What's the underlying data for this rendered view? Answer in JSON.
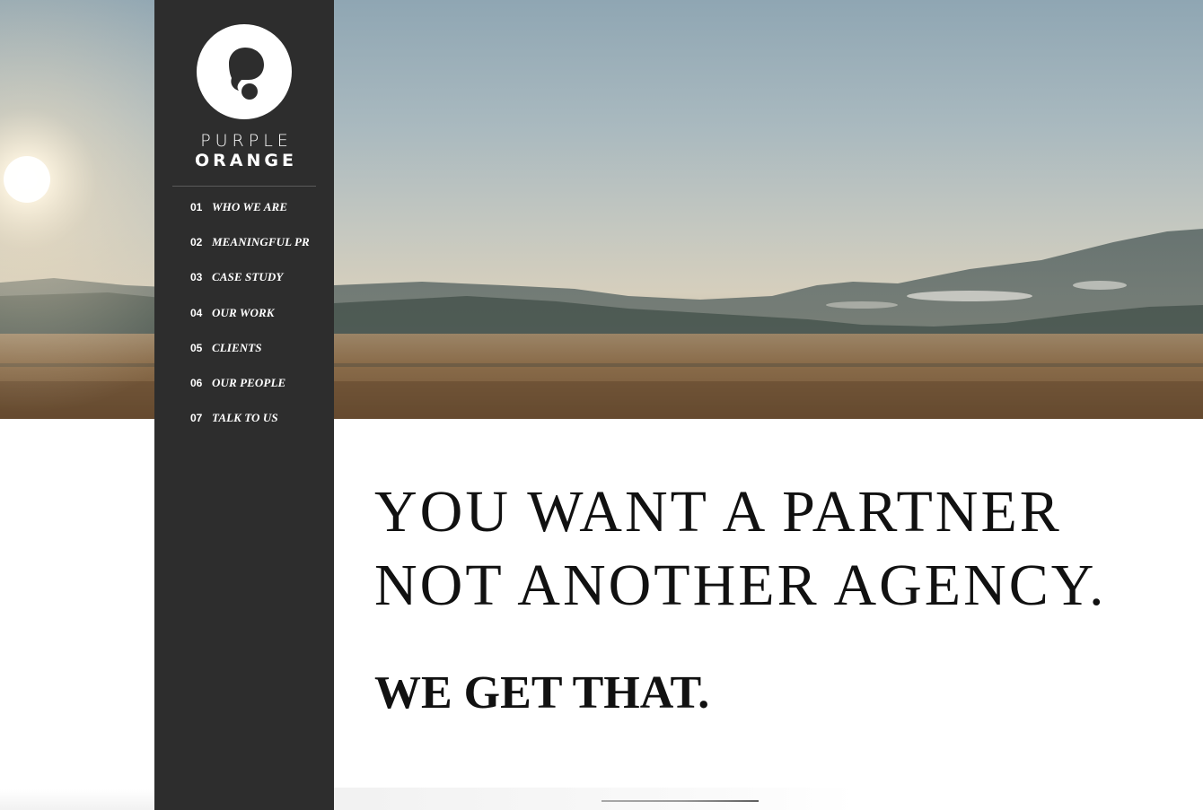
{
  "brand": {
    "line1": "PURPLE",
    "line2": "ORANGE",
    "logo_icon": "speech-bubble-logo-icon"
  },
  "nav": {
    "items": [
      {
        "num": "01",
        "label": "WHO WE ARE"
      },
      {
        "num": "02",
        "label": "MEANINGFUL PR"
      },
      {
        "num": "03",
        "label": "CASE STUDY"
      },
      {
        "num": "04",
        "label": "OUR WORK"
      },
      {
        "num": "05",
        "label": "CLIENTS"
      },
      {
        "num": "06",
        "label": "OUR PEOPLE"
      },
      {
        "num": "07",
        "label": "TALK TO US"
      }
    ]
  },
  "hero": {
    "image": "landscape-mountains-meadow-sunrise"
  },
  "main": {
    "headline_line1": "YOU WANT A PARTNER",
    "headline_line2": "NOT ANOTHER AGENCY.",
    "subhead": "WE GET THAT."
  },
  "colors": {
    "sidebar_bg": "#2d2d2d",
    "text_dark": "#111111",
    "text_light": "#ffffff"
  }
}
